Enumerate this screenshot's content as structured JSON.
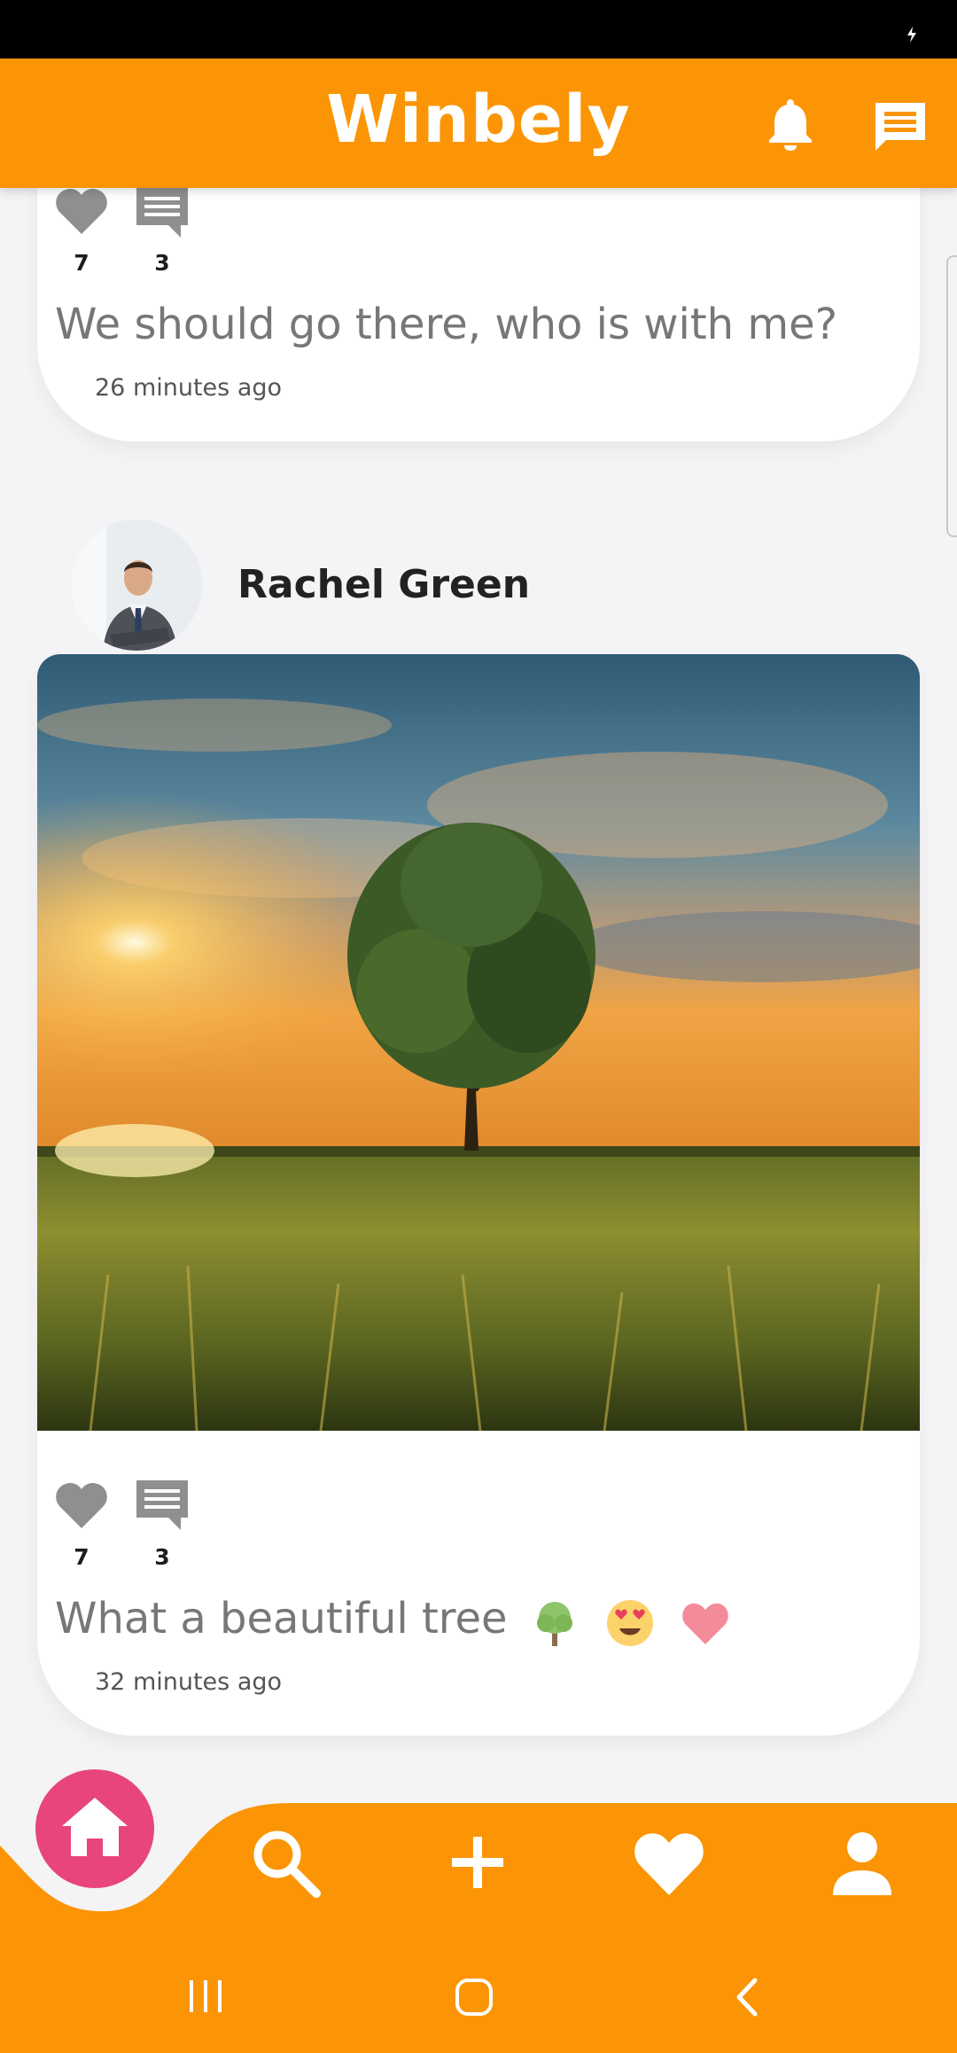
{
  "app": {
    "title": "Winbely"
  },
  "colors": {
    "accent": "#fb9505",
    "home_fab": "#e8457c",
    "card": "#ffffff",
    "icon_gray": "#8f8f8f"
  },
  "header_icons": [
    "bell-icon",
    "message-icon"
  ],
  "posts": [
    {
      "likes": "7",
      "comments": "3",
      "caption": "We should go there, who is with me?",
      "time": "26 minutes ago"
    },
    {
      "author": "Rachel Green",
      "image": "sunset-tree-field-photo",
      "likes": "7",
      "comments": "3",
      "caption": "What a beautiful tree",
      "emojis": [
        "tree-emoji",
        "heart-eyes-emoji",
        "pink-heart-emoji"
      ],
      "time": "32 minutes ago"
    }
  ],
  "bottom_nav": [
    "home-icon",
    "search-icon",
    "add-icon",
    "favorites-heart-icon",
    "profile-icon"
  ],
  "system_nav": [
    "recents-icon",
    "home-button-icon",
    "back-icon"
  ]
}
